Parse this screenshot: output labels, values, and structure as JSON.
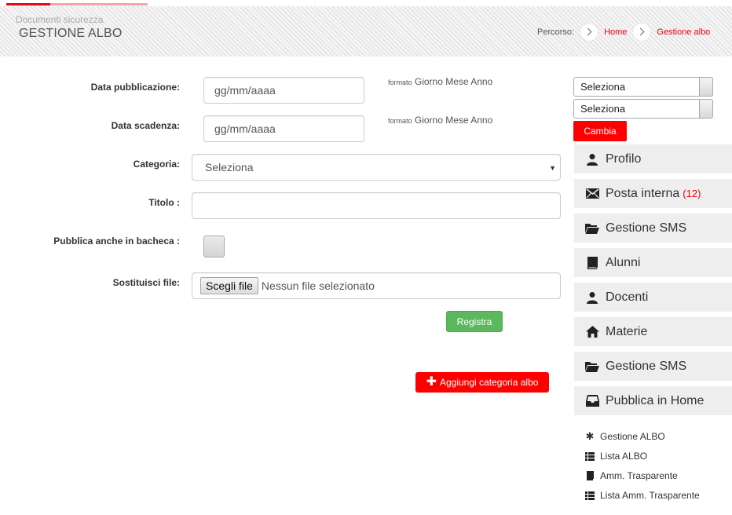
{
  "header": {
    "subtitle": "Documenti sicurezza",
    "title": "GESTIONE ALBO",
    "breadcrumb_label": "Percorso:",
    "breadcrumb": [
      "Home",
      "Gestione albo"
    ]
  },
  "form": {
    "data_pubblicazione": {
      "label": "Data pubblicazione:",
      "placeholder": "gg/mm/aaaa",
      "hint_small": "formato",
      "hint": "Giorno Mese Anno"
    },
    "data_scadenza": {
      "label": "Data scadenza:",
      "placeholder": "gg/mm/aaaa",
      "hint_small": "formato",
      "hint": "Giorno Mese Anno"
    },
    "categoria": {
      "label": "Categoria:",
      "value": "Seleziona"
    },
    "titolo": {
      "label": "Titolo :",
      "value": ""
    },
    "pubblica_bacheca": {
      "label": "Pubblica anche in bacheca :",
      "checked": false
    },
    "sostituisci_file": {
      "label": "Sostituisci file:",
      "button": "Scegli file",
      "status": "Nessun file selezionato"
    },
    "submit": "Registra",
    "add_category": "Aggiungi categoria albo"
  },
  "sidebar": {
    "select_1": "Seleziona",
    "select_2": "Seleziona",
    "cambia": "Cambia",
    "menu": [
      {
        "label": "Profilo",
        "icon": "user-icon"
      },
      {
        "label": "Posta interna",
        "count": "(12)",
        "icon": "envelope-icon"
      },
      {
        "label": "Gestione SMS",
        "icon": "folder-open-icon"
      },
      {
        "label": "Alunni",
        "icon": "book-icon"
      },
      {
        "label": "Docenti",
        "icon": "user-icon"
      },
      {
        "label": "Materie",
        "icon": "home-icon"
      },
      {
        "label": "Gestione SMS",
        "icon": "folder-open-icon"
      },
      {
        "label": "Pubblica in Home",
        "icon": "inbox-icon"
      }
    ],
    "submenu": [
      {
        "label": "Gestione ALBO",
        "icon": "asterisk-icon"
      },
      {
        "label": "Lista ALBO",
        "icon": "list-icon"
      },
      {
        "label": "Amm. Trasparente",
        "icon": "book-icon"
      },
      {
        "label": "Lista Amm. Trasparente",
        "icon": "list-icon"
      }
    ]
  },
  "colors": {
    "accent": "#e30613",
    "button_red": "#ff0000",
    "button_green": "#5cb85c",
    "nav_bg": "#eeeeee"
  }
}
